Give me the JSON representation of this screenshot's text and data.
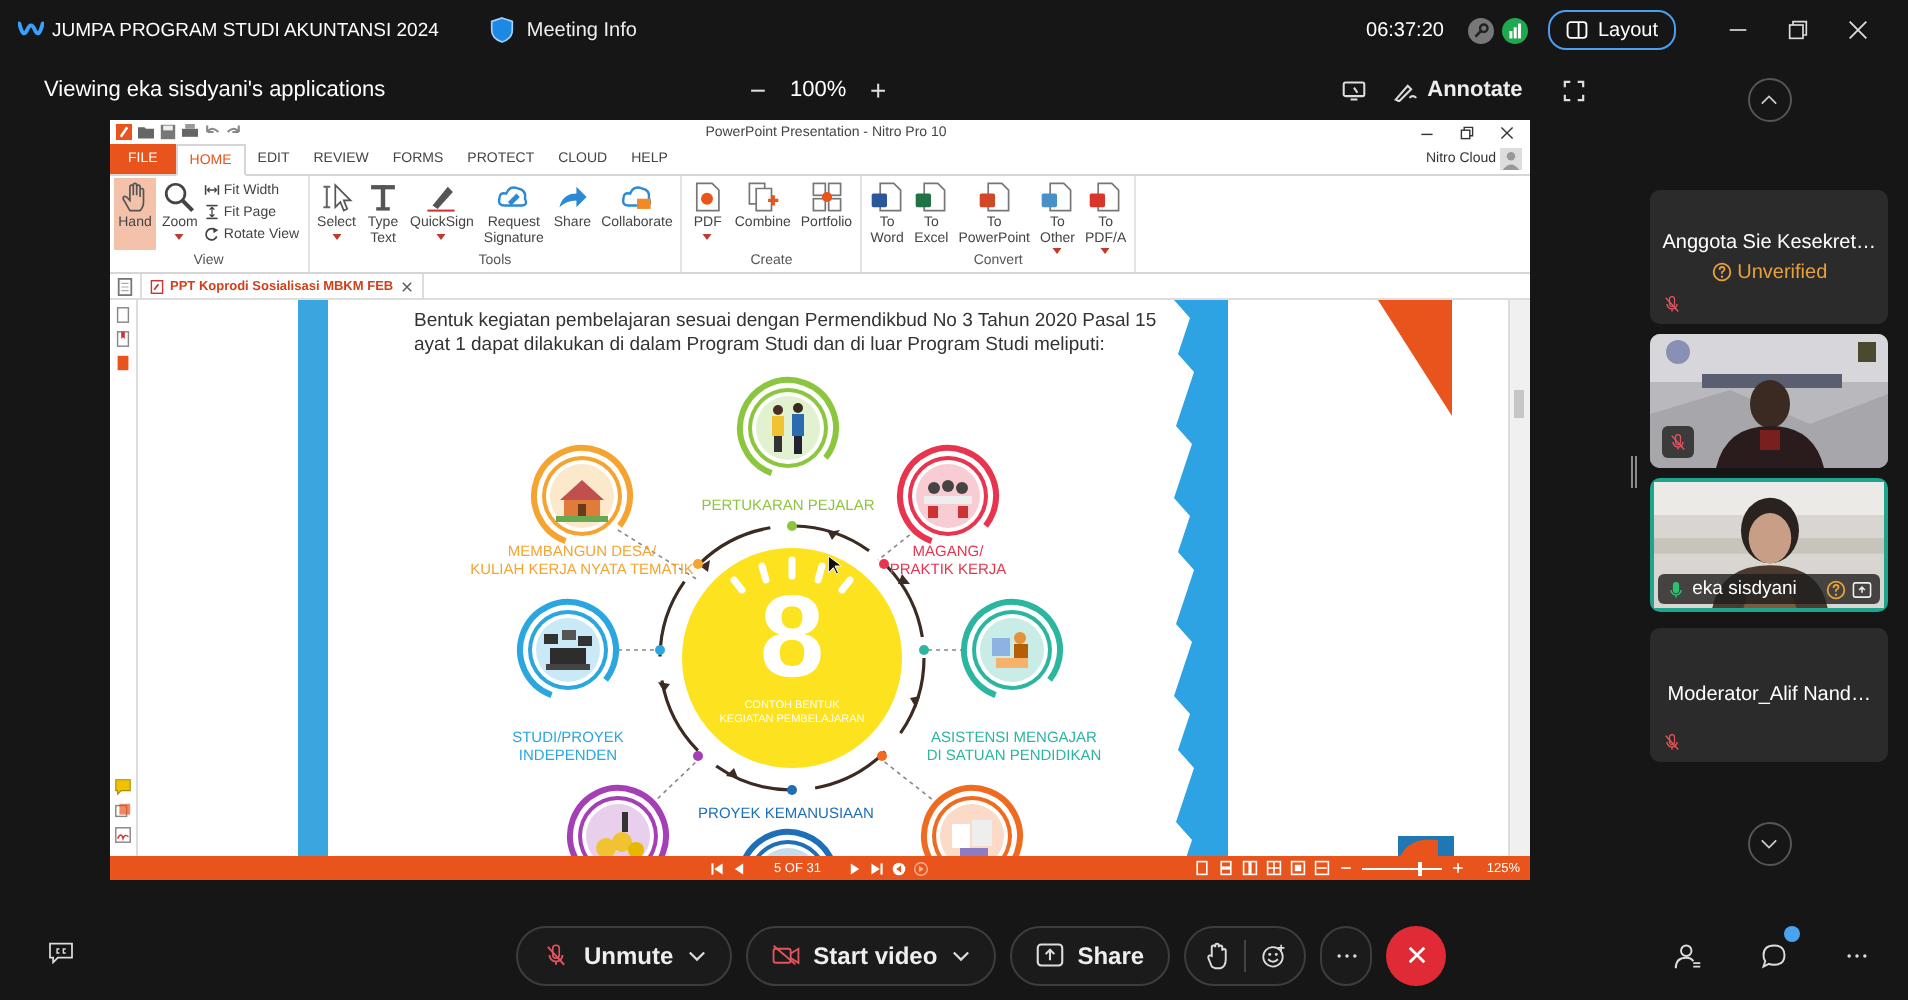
{
  "meeting": {
    "title": "JUMPA PROGRAM STUDI AKUNTANSI 2024",
    "info": "Meeting Info",
    "clock": "06:37:20",
    "layout": "Layout"
  },
  "share_bar": {
    "viewing": "Viewing eka sisdyani's applications",
    "zoom_out": "−",
    "zoom": "100%",
    "zoom_in": "+",
    "annotate": "Annotate"
  },
  "nitro": {
    "title": "PowerPoint Presentation - Nitro Pro 10",
    "account": "Nitro Cloud",
    "tabs": [
      {
        "label": "FILE",
        "kind": "file",
        "selected": false
      },
      {
        "label": "HOME",
        "kind": "tab",
        "selected": true
      },
      {
        "label": "EDIT",
        "kind": "tab",
        "selected": false
      },
      {
        "label": "REVIEW",
        "kind": "tab",
        "selected": false
      },
      {
        "label": "FORMS",
        "kind": "tab",
        "selected": false
      },
      {
        "label": "PROTECT",
        "kind": "tab",
        "selected": false
      },
      {
        "label": "CLOUD",
        "kind": "tab",
        "selected": false
      },
      {
        "label": "HELP",
        "kind": "tab",
        "selected": false
      }
    ],
    "groups": [
      {
        "label": "View",
        "tools": [
          {
            "label": "Hand",
            "kind": "large",
            "selected": true,
            "caret": false
          },
          {
            "label": "Zoom",
            "kind": "large",
            "selected": false,
            "caret": true
          },
          {
            "label": "Fit Width",
            "kind": "small",
            "selected": false,
            "caret": false
          },
          {
            "label": "Fit Page",
            "kind": "small",
            "selected": false,
            "caret": false
          },
          {
            "label": "Rotate View",
            "kind": "small",
            "selected": false,
            "caret": false
          }
        ]
      },
      {
        "label": "Tools",
        "tools": [
          {
            "label": "Select",
            "kind": "large",
            "selected": false,
            "caret": true
          },
          {
            "label": "Type\nText",
            "kind": "large",
            "selected": false,
            "caret": false
          },
          {
            "label": "QuickSign",
            "kind": "large",
            "selected": false,
            "caret": true
          },
          {
            "label": "Request\nSignature",
            "kind": "large",
            "selected": false,
            "caret": false
          },
          {
            "label": "Share",
            "kind": "large",
            "selected": false,
            "caret": false
          },
          {
            "label": "Collaborate",
            "kind": "large",
            "selected": false,
            "caret": false
          }
        ]
      },
      {
        "label": "Create",
        "tools": [
          {
            "label": "PDF",
            "kind": "large",
            "selected": false,
            "caret": true
          },
          {
            "label": "Combine",
            "kind": "large",
            "selected": false,
            "caret": false
          },
          {
            "label": "Portfolio",
            "kind": "large",
            "selected": false,
            "caret": false
          }
        ]
      },
      {
        "label": "Convert",
        "tools": [
          {
            "label": "To\nWord",
            "kind": "large",
            "selected": false,
            "caret": false
          },
          {
            "label": "To\nExcel",
            "kind": "large",
            "selected": false,
            "caret": false
          },
          {
            "label": "To\nPowerPoint",
            "kind": "large",
            "selected": false,
            "caret": false
          },
          {
            "label": "To\nOther",
            "kind": "large",
            "selected": false,
            "caret": true
          },
          {
            "label": "To\nPDF/A",
            "kind": "large",
            "selected": false,
            "caret": true
          }
        ]
      }
    ],
    "document_tab": "PPT Koprodi Sosialisasi MBKM FEB",
    "page": "5 OF 31",
    "zoom": "125%",
    "zoom_slider": {
      "level": 0.7
    }
  },
  "slide": {
    "paragraph": "Bentuk kegiatan pembelajaran sesuai dengan Permendikbud No 3 Tahun 2020 Pasal 15 ayat 1 dapat dilakukan di dalam Program Studi dan di luar Program Studi meliputi:",
    "number": "8",
    "caption": "CONTOH BENTUK\nKEGIATAN PEMBELAJARAN",
    "activities": [
      {
        "label": "PERTUKARAN PEJALAR",
        "color": "#8cc63f"
      },
      {
        "label": "MEMBANGUN DESA/\nKULIAH KERJA NYATA TEMATIK",
        "color": "#f5a431"
      },
      {
        "label": "MAGANG/\nPRAKTIK KERJA",
        "color": "#e8344e"
      },
      {
        "label": "STUDI/PROYEK\nINDEPENDEN",
        "color": "#2ba6de"
      },
      {
        "label": "ASISTENSI MENGAJAR\nDI SATUAN PENDIDIKAN",
        "color": "#2cb5a0"
      },
      {
        "label": "PROYEK KEMANUSIAAN",
        "color": "#1f6fb8"
      },
      {
        "color": "#a43fb5"
      },
      {
        "color": "#ee6b1f"
      }
    ]
  },
  "participants": [
    {
      "kind": "name",
      "name": "Anggota Sie Kesekret…",
      "status": "Unverified",
      "muted": true,
      "speaking": false
    },
    {
      "kind": "video",
      "muted": true,
      "speaking": false
    },
    {
      "kind": "video",
      "name": "eka sisdyani",
      "muted": false,
      "speaking": true,
      "unverified": true,
      "sharing": true
    },
    {
      "kind": "name",
      "name": "Moderator_Alif Nand…",
      "muted": true,
      "speaking": false
    }
  ],
  "controls": {
    "audio": "Unmute",
    "muted": true,
    "video": "Start video",
    "video_off": true,
    "share": "Share",
    "chat_unread": true
  }
}
